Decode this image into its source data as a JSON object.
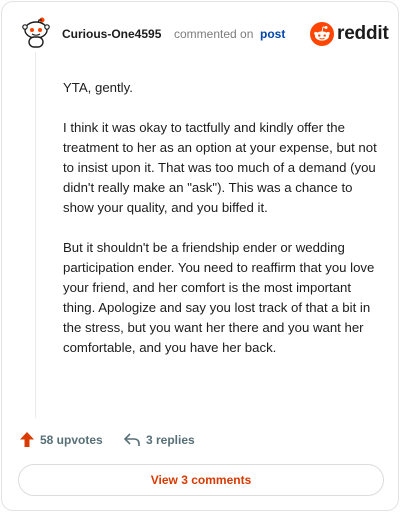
{
  "header": {
    "username": "Curious-One4595",
    "action_text": "commented on",
    "post_link": "post",
    "brand": "reddit"
  },
  "icons": {
    "avatar": "snoo-avatar-icon",
    "brand": "reddit-logo-icon",
    "upvote": "upvote-arrow-icon",
    "reply": "reply-arrow-icon"
  },
  "colors": {
    "brand_orange": "#ff4500",
    "upvote_red": "#d93a00",
    "link_blue": "#0045ac",
    "muted": "#576f76",
    "button_text": "#d93900"
  },
  "comment": {
    "paragraphs": [
      "YTA, gently.",
      "I think it was okay to tactfully and kindly offer the treatment to her as an option at your expense, but not to insist upon it. That was too much of a demand (you didn't really make an \"ask\"). This was a chance to show your quality, and you biffed it.",
      "But it shouldn't be a friendship ender or wedding participation ender. You need to reaffirm that you love your friend, and her comfort is the most important thing. Apologize and say you lost track of that a bit in the stress, but you want her there and you want her comfortable, and you have her back."
    ]
  },
  "actions": {
    "upvotes": "58 upvotes",
    "replies": "3 replies"
  },
  "footer": {
    "view_comments": "View 3 comments"
  }
}
